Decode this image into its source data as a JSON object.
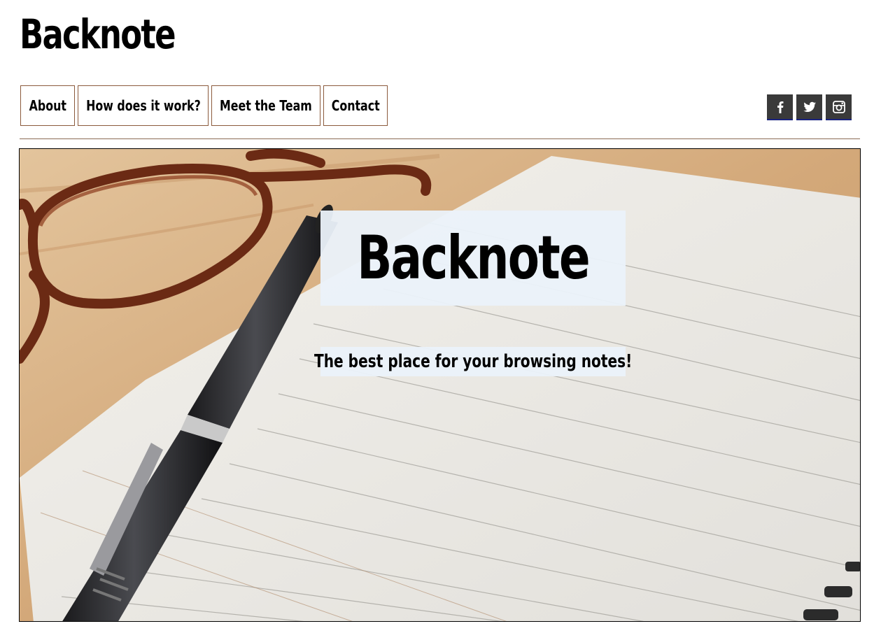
{
  "header": {
    "site_title": "Backnote"
  },
  "nav": {
    "items": [
      {
        "label": "About"
      },
      {
        "label": "How does it work?"
      },
      {
        "label": "Meet the Team"
      },
      {
        "label": "Contact"
      }
    ]
  },
  "social": {
    "icons": [
      "facebook-icon",
      "twitter-icon",
      "instagram-icon"
    ]
  },
  "hero": {
    "title": "Backnote",
    "subtitle": "The best place for your browsing notes!"
  },
  "colors": {
    "nav_border": "#8b5a3c",
    "social_bg": "#3a3a3a",
    "overlay_bg": "#ebf2fa"
  }
}
